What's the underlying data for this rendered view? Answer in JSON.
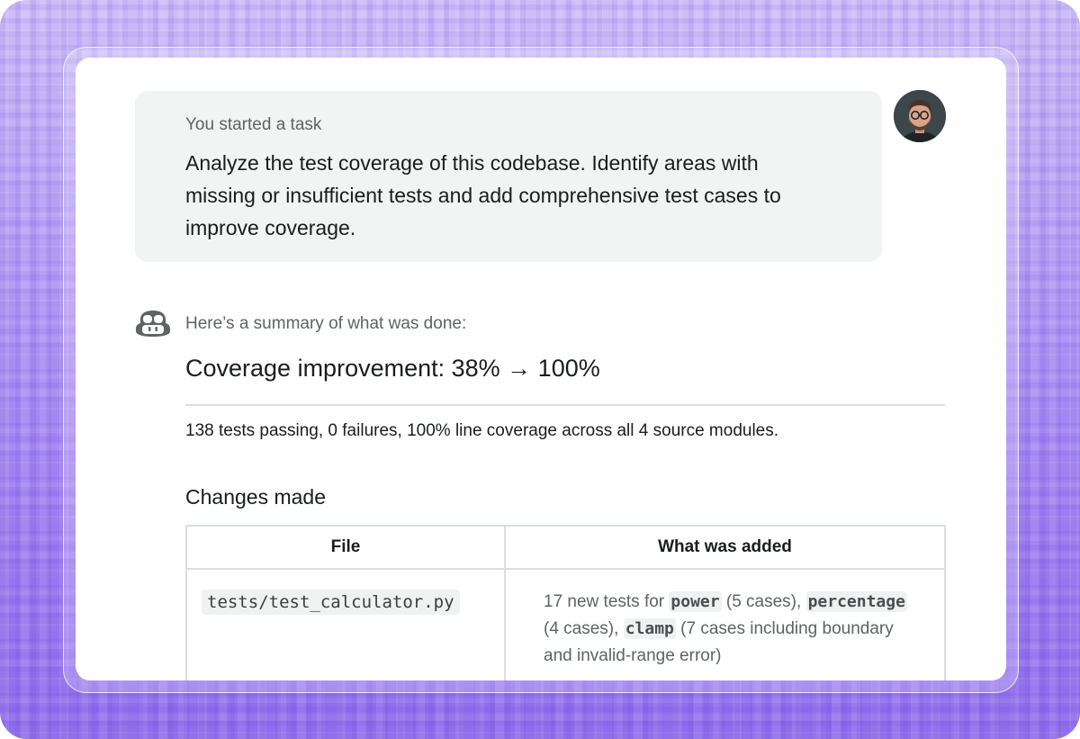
{
  "task": {
    "heading": "You started a task",
    "text": "Analyze the test coverage of this codebase. Identify areas with missing or insufficient tests and add comprehensive test cases to improve coverage."
  },
  "user": {
    "avatar_icon": "user-avatar"
  },
  "agent": {
    "icon": "copilot-icon",
    "intro": "Here’s a summary of what was done:",
    "title": "Coverage improvement: 38% → 100%",
    "result": "138 tests passing, 0 failures, 100% line coverage across all 4 source modules.",
    "changes_heading": "Changes made",
    "table": {
      "headers": [
        "File",
        "What was added"
      ],
      "rows": [
        {
          "file": "tests/test_calculator.py",
          "added": {
            "t1": "17 new tests for ",
            "c1": "power",
            "t2": " (5 cases), ",
            "c2": "percentage",
            "t3": " (4 cases), ",
            "c3": "clamp",
            "t4": " (7 cases including boundary and invalid-range error)"
          }
        }
      ]
    }
  },
  "colors": {
    "background_top": "#cbbdf7",
    "background_bottom": "#8e6beb",
    "bubble": "#f2f3f3",
    "text": "#1b1d1d",
    "muted": "#5f6363"
  }
}
